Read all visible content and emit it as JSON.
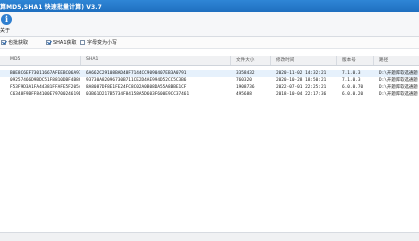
{
  "window": {
    "title": "算MD5,SHA1 快速批量计算) V3.7"
  },
  "ribbon": {
    "about_label": "关于",
    "about_icon": "info-icon"
  },
  "options": [
    {
      "label": "也批获取",
      "checked": true
    },
    {
      "label": "SHA1获取",
      "checked": true
    },
    {
      "label": "字母变为小写",
      "checked": false
    }
  ],
  "table": {
    "columns": [
      "MD5",
      "SHA1",
      "文件大小",
      "修改时间",
      "版本号",
      "路径"
    ],
    "rows": [
      [
        "B0E8C6EF73011667AFEEBC06A97712",
        "6A662C29108BAD48F7144CC9090407EB3A0791",
        "3358432",
        "2020-11-02 14:32:21",
        "7.1.0.3",
        "D:\\开题库软选通题"
      ],
      [
        "09257466D9BDC51F8810DBF4B8CE7C",
        "93730A82096730B711CE2D4AE994D52CC5C3B6",
        "760320",
        "2020-10-28 18:50:21",
        "7.1.0.3",
        "D:\\开题库软选通题"
      ],
      [
        "F53F9D3A1FA44381FFAFE5F20548FEB6",
        "8A8087DF8E1FE24FC8C02A0B08DA55A8BBE1CF",
        "1908736",
        "2022-07-01 22:25:21",
        "6.0.0.70",
        "D:\\开题库软选通题"
      ],
      [
        "C6348F9BFF84100E7970024619DF6A38A",
        "03B61D217B5734F84158A5D603F600E9CC37461",
        "495688",
        "2018-10-04 22:17:36",
        "6.0.0.20",
        "D:\\开题库软选通题"
      ]
    ]
  },
  "colors": {
    "title_bar": "#1f6fc0",
    "accent": "#2f7fd0",
    "selected_row": "#e6f1fc"
  }
}
